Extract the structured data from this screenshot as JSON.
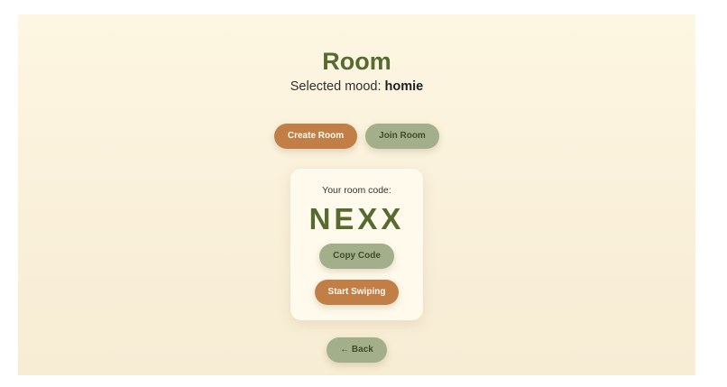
{
  "room": {
    "title": "Room",
    "mood_prefix": "Selected mood: ",
    "mood_value": "homie"
  },
  "actions": {
    "create_label": "Create Room",
    "join_label": "Join Room"
  },
  "code_card": {
    "label": "Your room code:",
    "code": "NEXX",
    "copy_label": "Copy Code",
    "start_label": "Start Swiping"
  },
  "nav": {
    "back_label": "← Back"
  },
  "colors": {
    "accent_orange": "#c17f47",
    "accent_sage": "#a3af8a",
    "title_green": "#556b2f",
    "background": "#fdf6e2"
  }
}
